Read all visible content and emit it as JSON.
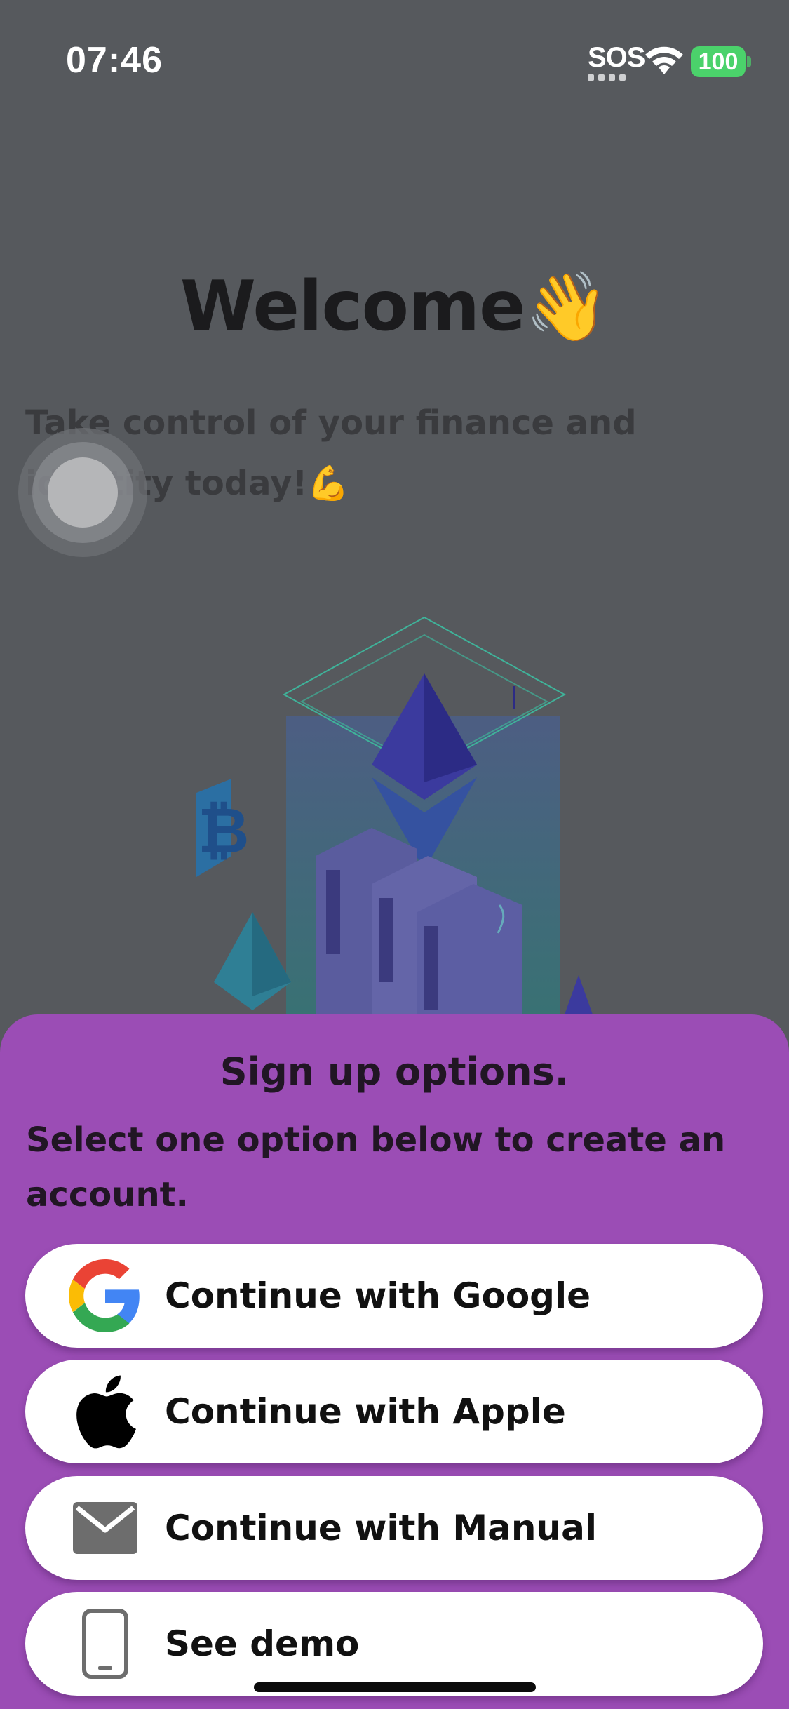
{
  "status_bar": {
    "time": "07:46",
    "sos": "SOS",
    "battery": "100",
    "battery_color": "#4bd26b"
  },
  "welcome": {
    "title": "Welcome",
    "title_emoji": "👋",
    "subtitle": "Take control of your finance and identity today!",
    "subtitle_emoji": "💪"
  },
  "sheet": {
    "background": "#9b4db5",
    "title": "Sign up options.",
    "subtitle": "Select one option below to create an account.",
    "options": [
      {
        "label": "Continue with Google",
        "icon": "google-icon"
      },
      {
        "label": "Continue with Apple",
        "icon": "apple-icon"
      },
      {
        "label": "Continue with Manual",
        "icon": "mail-icon"
      },
      {
        "label": "See demo",
        "icon": "phone-icon"
      }
    ]
  }
}
